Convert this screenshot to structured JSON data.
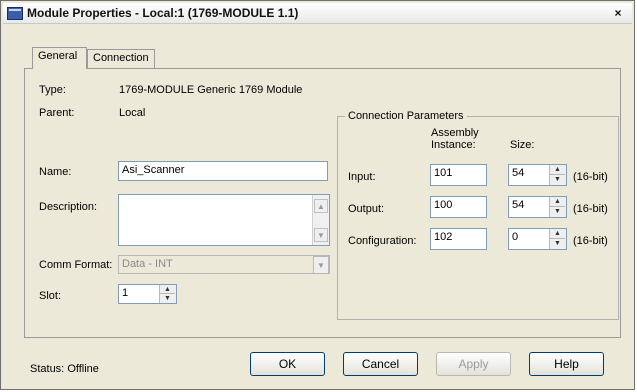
{
  "window": {
    "title": "Module Properties - Local:1 (1769-MODULE 1.1)",
    "close_icon": "×"
  },
  "tabs": [
    {
      "label": "General",
      "active": true
    },
    {
      "label": "Connection",
      "active": false
    }
  ],
  "general": {
    "type_label": "Type:",
    "type_value": "1769-MODULE Generic 1769 Module",
    "parent_label": "Parent:",
    "parent_value": "Local",
    "name_label": "Name:",
    "name_value": "Asi_Scanner",
    "description_label": "Description:",
    "description_value": "",
    "comm_format_label": "Comm Format:",
    "comm_format_value": "Data - INT",
    "slot_label": "Slot:",
    "slot_value": "1"
  },
  "connection_params": {
    "title": "Connection Parameters",
    "assembly_header_1": "Assembly",
    "assembly_header_2": "Instance:",
    "size_header": "Size:",
    "rows": [
      {
        "label": "Input:",
        "assembly": "101",
        "size": "54",
        "unit": "(16-bit)"
      },
      {
        "label": "Output:",
        "assembly": "100",
        "size": "54",
        "unit": "(16-bit)"
      },
      {
        "label": "Configuration:",
        "assembly": "102",
        "size": "0",
        "unit": "(16-bit)"
      }
    ]
  },
  "status": {
    "label": "Status:",
    "value": "Offline"
  },
  "buttons": {
    "ok": "OK",
    "cancel": "Cancel",
    "apply": "Apply",
    "help": "Help"
  },
  "icons": {
    "window": "module-window-icon",
    "scroll_up": "▲",
    "scroll_down": "▼",
    "dropdown": "▼",
    "spin_up": "▲",
    "spin_down": "▼"
  }
}
